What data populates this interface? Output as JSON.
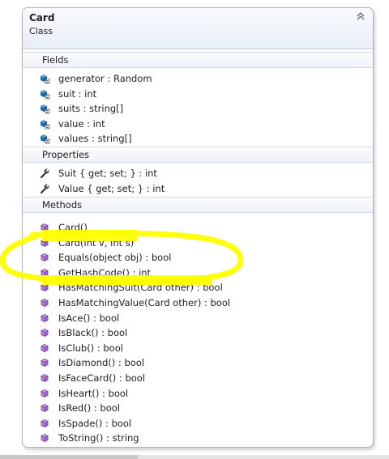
{
  "class_name": "Card",
  "class_kind": "Class",
  "collapse_glyph": "⌃",
  "sections": {
    "fields": "Fields",
    "properties": "Properties",
    "methods": "Methods"
  },
  "fields": [
    {
      "name": "generator",
      "type": " : Random"
    },
    {
      "name": "suit",
      "type": " : int"
    },
    {
      "name": "suits",
      "type": " : string[]"
    },
    {
      "name": "value",
      "type": " : int"
    },
    {
      "name": "values",
      "type": " : string[]"
    }
  ],
  "properties": [
    {
      "name": "Suit { get; set; }",
      "type": " : int"
    },
    {
      "name": "Value { get; set; }",
      "type": " : int"
    }
  ],
  "methods": [
    "Card()",
    "Card(int v, int s)",
    "Equals(object obj) : bool",
    "GetHashCode() : int",
    "HasMatchingSuit(Card other) : bool",
    "HasMatchingValue(Card other) : bool",
    "IsAce() : bool",
    "IsBlack() : bool",
    "IsClub() : bool",
    "IsDiamond() : bool",
    "IsFaceCard() : bool",
    "IsHeart() : bool",
    "IsRed() : bool",
    "IsSpade() : bool",
    "ToString() : string"
  ],
  "colors": {
    "highlight": "#ffff00",
    "field_icon": "#1f6fb5",
    "method_icon": "#7b3fa8",
    "border": "#a9b3c2"
  },
  "icons": {
    "field": "field-icon",
    "property": "wrench-icon",
    "method": "method-cube-icon"
  }
}
